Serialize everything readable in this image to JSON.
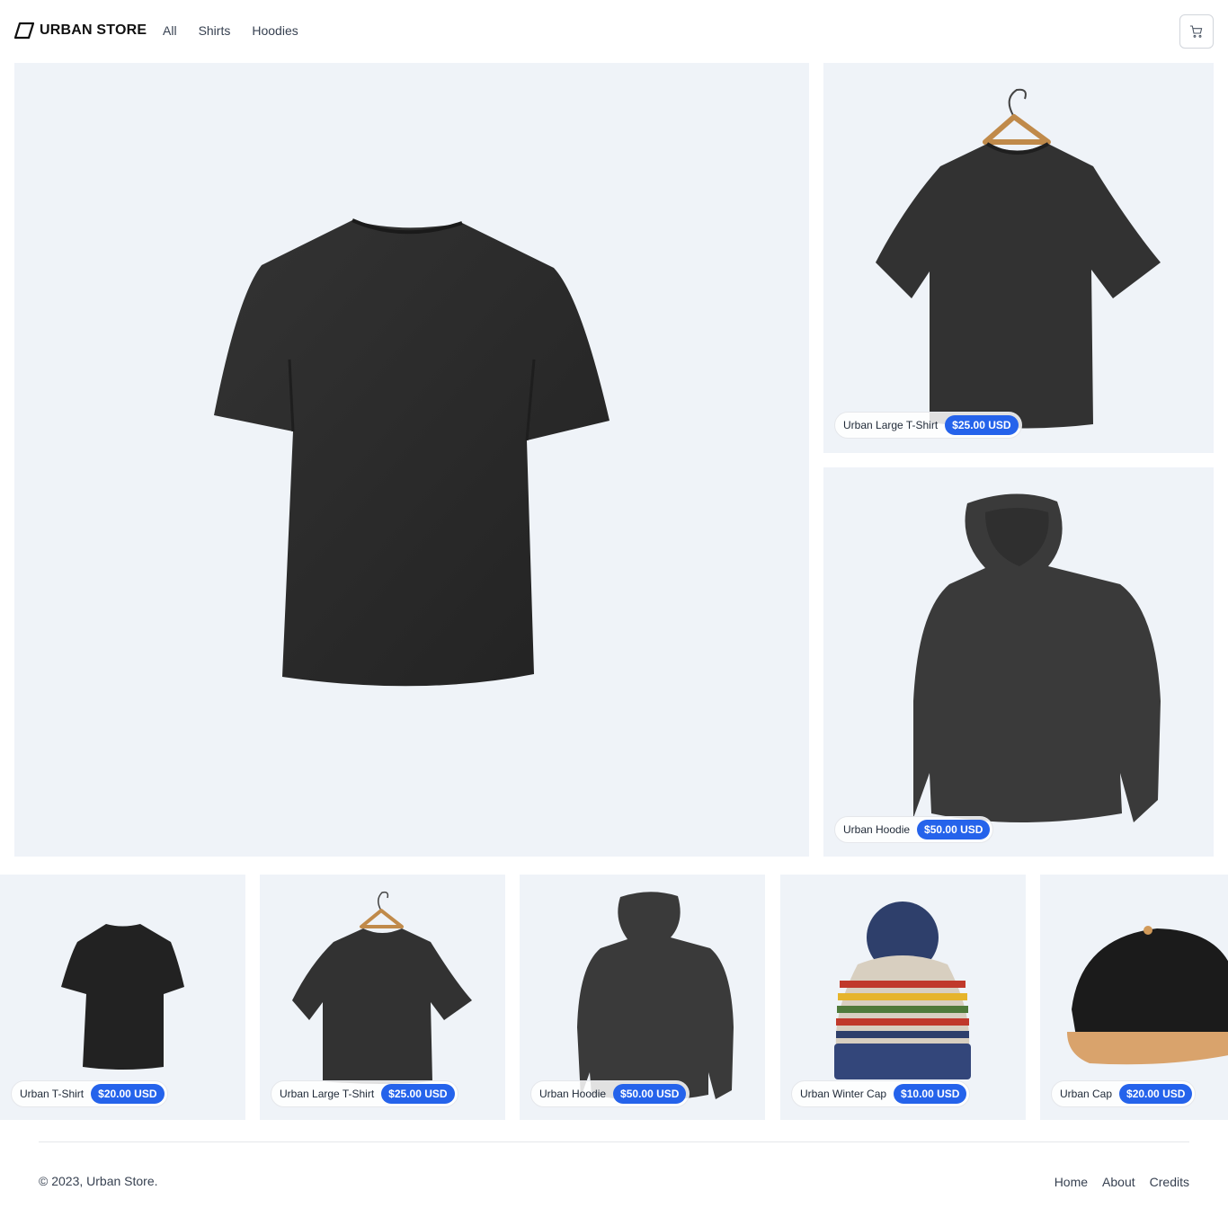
{
  "brand": {
    "name": "URBAN STORE"
  },
  "nav": {
    "items": [
      "All",
      "Shirts",
      "Hoodies"
    ]
  },
  "header": {
    "cart_icon": "cart-icon"
  },
  "colors": {
    "accent": "#2563eb",
    "tile_bg": "#eff3f8",
    "garment": "#2b2b2b"
  },
  "featured": {
    "main": {
      "product": "t-shirt"
    },
    "right_top": {
      "name": "Urban Large T-Shirt",
      "price": "$25.00 USD",
      "product": "t-shirt-hanger"
    },
    "right_bottom": {
      "name": "Urban Hoodie",
      "price": "$50.00 USD",
      "product": "hoodie"
    }
  },
  "carousel": [
    {
      "name": "Urban T-Shirt",
      "price": "$20.00 USD",
      "product": "t-shirt"
    },
    {
      "name": "Urban Large T-Shirt",
      "price": "$25.00 USD",
      "product": "t-shirt-hanger"
    },
    {
      "name": "Urban Hoodie",
      "price": "$50.00 USD",
      "product": "hoodie"
    },
    {
      "name": "Urban Winter Cap",
      "price": "$10.00 USD",
      "product": "beanie"
    },
    {
      "name": "Urban Cap",
      "price": "$20.00 USD",
      "product": "cap"
    }
  ],
  "footer": {
    "copyright": "© 2023, Urban Store.",
    "links": [
      "Home",
      "About",
      "Credits"
    ]
  }
}
